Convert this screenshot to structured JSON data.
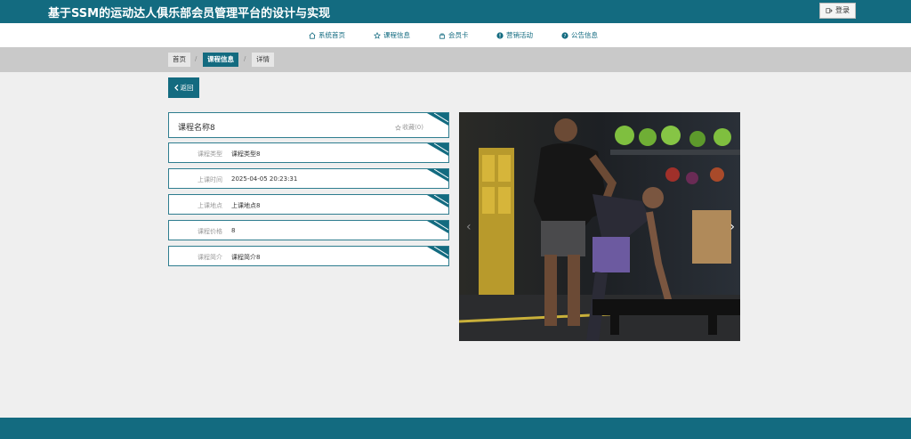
{
  "header": {
    "site_title": "基于SSM的运动达人俱乐部会员管理平台的设计与实现",
    "login_label": "登录"
  },
  "nav": {
    "items": [
      {
        "label": "系统首页",
        "icon": "home-icon"
      },
      {
        "label": "课程信息",
        "icon": "star-icon"
      },
      {
        "label": "会员卡",
        "icon": "bag-icon"
      },
      {
        "label": "营销活动",
        "icon": "info-icon"
      },
      {
        "label": "公告信息",
        "icon": "help-icon"
      }
    ]
  },
  "breadcrumb": {
    "items": [
      "首页",
      "课程信息",
      "详情"
    ],
    "active_index": 1,
    "separator": "/"
  },
  "back_button": {
    "label": "返回"
  },
  "course": {
    "name": "课程名称8",
    "favorite_label": "收藏(0)",
    "fields": [
      {
        "label": "课程类型",
        "value": "课程类型8"
      },
      {
        "label": "上课时间",
        "value": "2025-04-05 20:23:31"
      },
      {
        "label": "上课地点",
        "value": "上课地点8"
      },
      {
        "label": "课程价格",
        "value": "8"
      },
      {
        "label": "课程简介",
        "value": "课程简介8"
      }
    ]
  },
  "carousel": {
    "prev_glyph": "‹",
    "next_glyph": "›"
  },
  "colors": {
    "primary": "#136b80",
    "breadcrumb_bg": "#c9c9c9",
    "page_bg": "#efefef"
  }
}
